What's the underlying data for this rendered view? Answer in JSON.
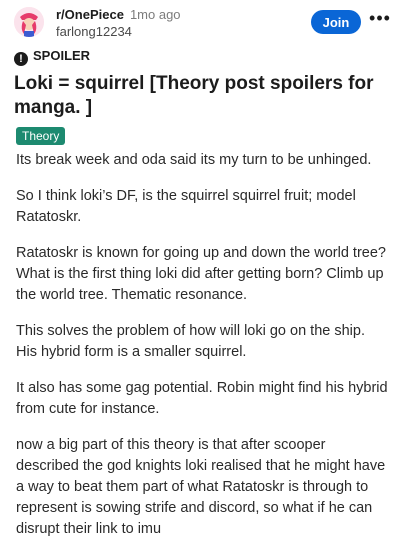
{
  "post": {
    "subreddit": "r/OnePiece",
    "age": "1mo ago",
    "author": "farlong12234",
    "join_label": "Join",
    "more_label": "•••",
    "spoiler_label": "SPOILER",
    "title": "Loki = squirrel [Theory post spoilers for manga. ]",
    "flair": "Theory",
    "flair_color": "#1d8a70",
    "join_color": "#0a66d6",
    "avatar_icon": "one-piece-character-avatar",
    "paragraphs": [
      "Its break week and oda said its my turn to be unhinged.",
      "So I think loki’s DF,  is the squirrel squirrel fruit; model Ratatoskr.",
      "Ratatoskr is known for going up and down the world tree? What is the first thing loki did after getting born? Climb up the world tree. Thematic resonance.",
      "This solves the problem of how will loki go on the ship. His hybrid form is a smaller squirrel.",
      "It also has some gag potential. Robin might find his hybrid from cute for instance.",
      "now a big part of this theory is that after scooper described the god knights loki realised that he might have a way to beat them part of what Ratatoskr is through to represent is sowing strife and discord, so what if he can disrupt their link to imu"
    ]
  }
}
